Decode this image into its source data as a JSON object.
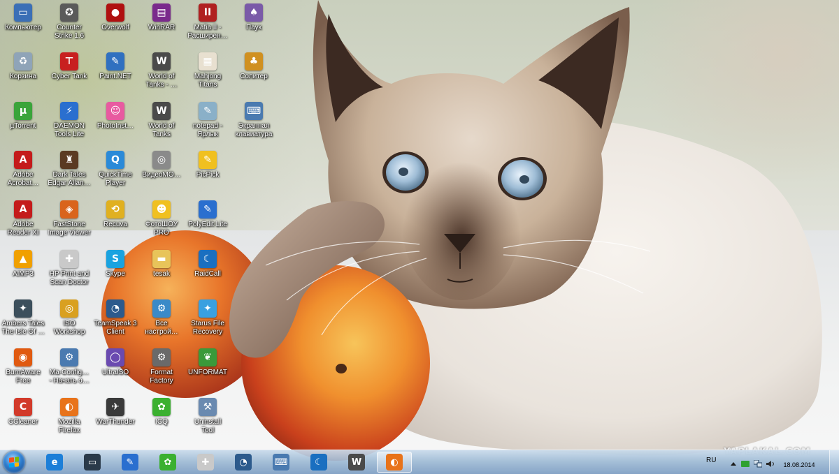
{
  "desktop": {
    "columns": [
      [
        {
          "label": "Компьютер",
          "icon": "computer-icon",
          "color": "#3b6fb6",
          "glyph": "▭"
        },
        {
          "label": "Корзина",
          "icon": "recycle-bin-icon",
          "color": "#8fa4b8",
          "glyph": "♻"
        },
        {
          "label": "µTorrent",
          "icon": "utorrent-icon",
          "color": "#3aa43a",
          "glyph": "µ"
        },
        {
          "label": "Adobe\nAcrobat…",
          "icon": "acrobat-icon",
          "color": "#c41b1b",
          "glyph": "A"
        },
        {
          "label": "Adobe\nReader XI",
          "icon": "adobe-reader-icon",
          "color": "#c41b1b",
          "glyph": "A"
        },
        {
          "label": "AIMP3",
          "icon": "aimp-icon",
          "color": "#f0a000",
          "glyph": "▲"
        },
        {
          "label": "Ambers Tales\nThe Isle Of …",
          "icon": "game-icon",
          "color": "#3c4f5c",
          "glyph": "✦"
        },
        {
          "label": "BurnAware\nFree",
          "icon": "burnaware-icon",
          "color": "#e05a10",
          "glyph": "◉"
        },
        {
          "label": "CCleaner",
          "icon": "ccleaner-icon",
          "color": "#d23a2a",
          "glyph": "C"
        }
      ],
      [
        {
          "label": "Counter\nStrike 1.6",
          "icon": "counter-strike-icon",
          "color": "#5a5a5a",
          "glyph": "✪"
        },
        {
          "label": "Cyber Tank",
          "icon": "cyber-tank-icon",
          "color": "#c82020",
          "glyph": "⊤"
        },
        {
          "label": "DAEMON\nTools Lite",
          "icon": "daemon-tools-icon",
          "color": "#2a6fcf",
          "glyph": "⚡"
        },
        {
          "label": "Dark Tales\nEdgar Allan…",
          "icon": "dark-tales-icon",
          "color": "#5a3a22",
          "glyph": "♜"
        },
        {
          "label": "FastStone\nImage Viewer",
          "icon": "faststone-icon",
          "color": "#d9641c",
          "glyph": "◈"
        },
        {
          "label": "HP Print and\nScan Doctor",
          "icon": "hp-doctor-icon",
          "color": "#c9c9c9",
          "glyph": "✚"
        },
        {
          "label": "ISO\nWorkshop",
          "icon": "iso-workshop-icon",
          "color": "#d9a020",
          "glyph": "◎"
        },
        {
          "label": "Ma-Config…\n- Начать о…",
          "icon": "ma-config-icon",
          "color": "#4a7ab0",
          "glyph": "⚙"
        },
        {
          "label": "Mozilla\nFirefox",
          "icon": "firefox-icon",
          "color": "#e8731a",
          "glyph": "◐"
        }
      ],
      [
        {
          "label": "Overwolf",
          "icon": "overwolf-icon",
          "color": "#b01010",
          "glyph": "●"
        },
        {
          "label": "Paint.NET",
          "icon": "paint-net-icon",
          "color": "#3070c0",
          "glyph": "✎"
        },
        {
          "label": "PhotoInst…",
          "icon": "photoinstrument-icon",
          "color": "#e85aa0",
          "glyph": "☺"
        },
        {
          "label": "QuickTime\nPlayer",
          "icon": "quicktime-icon",
          "color": "#2b8ad8",
          "glyph": "Q"
        },
        {
          "label": "Recuva",
          "icon": "recuva-icon",
          "color": "#e0b020",
          "glyph": "⟲"
        },
        {
          "label": "Skype",
          "icon": "skype-icon",
          "color": "#1aa3e0",
          "glyph": "S"
        },
        {
          "label": "TeamSpeak 3\nClient",
          "icon": "teamspeak-icon",
          "color": "#2c5a8c",
          "glyph": "◔"
        },
        {
          "label": "UltraISO",
          "icon": "ultraiso-icon",
          "color": "#6a4ab0",
          "glyph": "◯"
        },
        {
          "label": "WarThunder",
          "icon": "warthunder-icon",
          "color": "#3a3a3a",
          "glyph": "✈"
        }
      ],
      [
        {
          "label": "WinRAR",
          "icon": "winrar-icon",
          "color": "#7a2a8c",
          "glyph": "▤"
        },
        {
          "label": "World of\nTanks - …",
          "icon": "world-of-tanks-icon",
          "color": "#4a4a4a",
          "glyph": "W"
        },
        {
          "label": "World of\nTanks",
          "icon": "world-of-tanks-icon",
          "color": "#4a4a4a",
          "glyph": "W"
        },
        {
          "label": "ВидеоМО…",
          "icon": "videomaster-icon",
          "color": "#8a8a8a",
          "glyph": "◎"
        },
        {
          "label": "ФотоШОУ\nPRO",
          "icon": "fotoshow-icon",
          "color": "#f0c020",
          "glyph": "☻"
        },
        {
          "label": "tesak",
          "icon": "folder-icon",
          "color": "#e8c45a",
          "glyph": "▬"
        },
        {
          "label": "Все\nнастрой…",
          "icon": "settings-icon",
          "color": "#3a8ac8",
          "glyph": "⚙"
        },
        {
          "label": "Format\nFactory",
          "icon": "format-factory-icon",
          "color": "#6a6a6a",
          "glyph": "⚙"
        },
        {
          "label": "ICQ",
          "icon": "icq-icon",
          "color": "#3bb030",
          "glyph": "✿"
        }
      ],
      [
        {
          "label": "Mafia II -\nРасширен…",
          "icon": "mafia-icon",
          "color": "#b02020",
          "glyph": "II"
        },
        {
          "label": "Mahjong\nTitans",
          "icon": "mahjong-icon",
          "color": "#e8e0d0",
          "glyph": "▦"
        },
        {
          "label": "notepad -\nЯрлык",
          "icon": "notepad-icon",
          "color": "#8ab0c8",
          "glyph": "✎"
        },
        {
          "label": "PicPick",
          "icon": "picpick-icon",
          "color": "#f0c020",
          "glyph": "✎"
        },
        {
          "label": "PolyEdit Lite",
          "icon": "polyedit-icon",
          "color": "#2a6fcf",
          "glyph": "✎"
        },
        {
          "label": "RaidCall",
          "icon": "raidcall-icon",
          "color": "#1a6fc0",
          "glyph": "☾"
        },
        {
          "label": "Starus File\nRecovery",
          "icon": "starus-icon",
          "color": "#3aa0e0",
          "glyph": "✦"
        },
        {
          "label": "UNFORMAT",
          "icon": "unformat-icon",
          "color": "#3a9a3a",
          "glyph": "❦"
        },
        {
          "label": "Uninstall\nTool",
          "icon": "uninstall-tool-icon",
          "color": "#6a8ab0",
          "glyph": "⚒"
        }
      ],
      [
        {
          "label": "Паук",
          "icon": "spider-solitaire-icon",
          "color": "#7a5aa8",
          "glyph": "♠"
        },
        {
          "label": "Солитер",
          "icon": "solitaire-icon",
          "color": "#d09020",
          "glyph": "♣"
        },
        {
          "label": "Экранная\nклавиатура",
          "icon": "on-screen-keyboard-icon",
          "color": "#4a7ab0",
          "glyph": "⌨"
        }
      ]
    ]
  },
  "watermark": "YAPLAKAL.COM",
  "taskbar": {
    "pinned": [
      {
        "name": "internet-explorer-icon",
        "color": "#1c7fd8",
        "glyph": "e"
      },
      {
        "name": "printer-icon",
        "color": "#2a3a4a",
        "glyph": "▭"
      },
      {
        "name": "polyedit-icon",
        "color": "#2a6fcf",
        "glyph": "✎"
      },
      {
        "name": "icq-icon",
        "color": "#3bb030",
        "glyph": "✿"
      },
      {
        "name": "hp-doctor-icon",
        "color": "#c9c9c9",
        "glyph": "✚"
      },
      {
        "name": "teamspeak-icon",
        "color": "#2c5a8c",
        "glyph": "◔"
      },
      {
        "name": "on-screen-keyboard-icon",
        "color": "#4a7ab0",
        "glyph": "⌨"
      },
      {
        "name": "raidcall-icon",
        "color": "#1a6fc0",
        "glyph": "☾"
      },
      {
        "name": "world-of-tanks-icon",
        "color": "#4a4a4a",
        "glyph": "W"
      },
      {
        "name": "firefox-icon",
        "color": "#e8731a",
        "glyph": "◐",
        "active": true
      }
    ],
    "language": "RU",
    "date": "18.08.2014"
  }
}
